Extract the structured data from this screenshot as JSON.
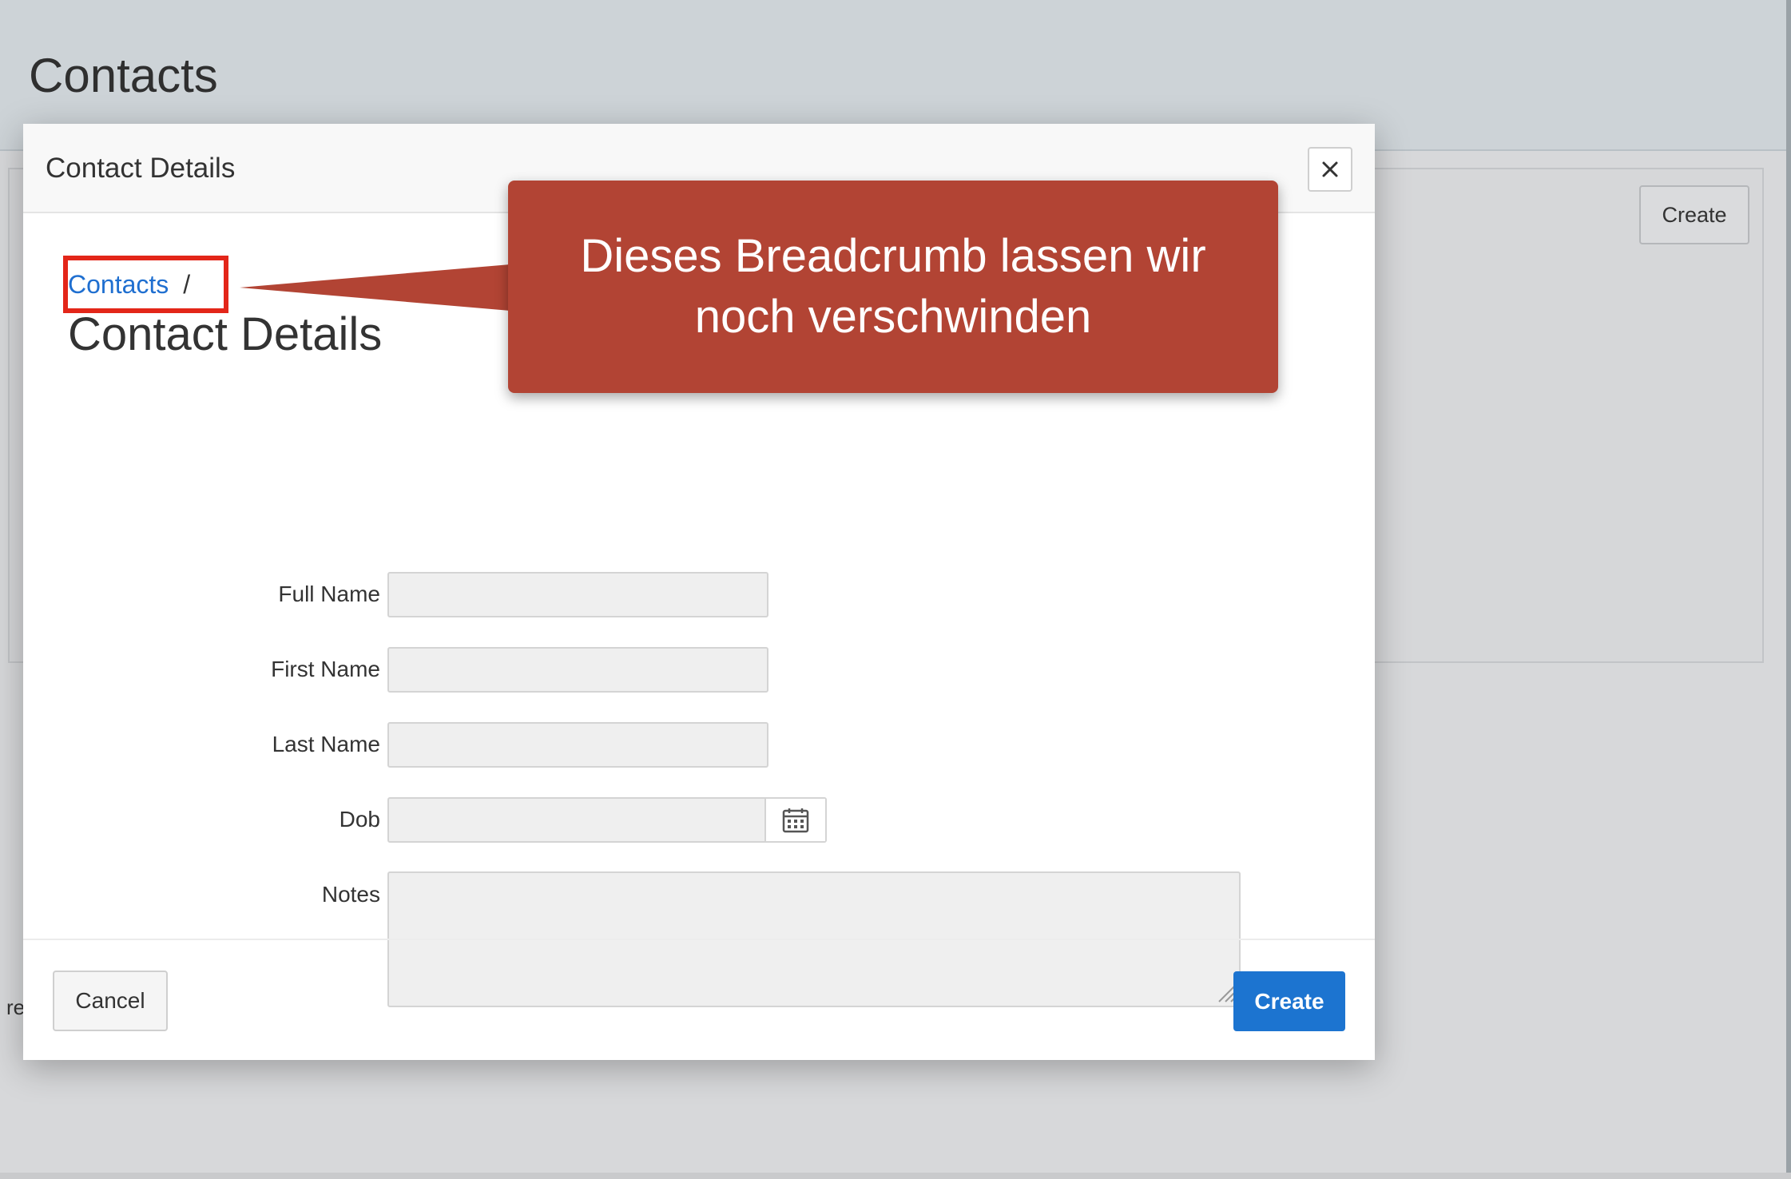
{
  "background": {
    "page_title": "Contacts",
    "create_label": "Create",
    "stray_text": "re"
  },
  "dialog": {
    "title": "Contact Details",
    "close_glyph": "✕",
    "breadcrumb": {
      "link_label": "Contacts",
      "separator": "/"
    },
    "heading": "Contact Details",
    "fields": {
      "full_name": {
        "label": "Full Name",
        "value": ""
      },
      "first_name": {
        "label": "First Name",
        "value": ""
      },
      "last_name": {
        "label": "Last Name",
        "value": ""
      },
      "dob": {
        "label": "Dob",
        "value": "",
        "icon": "calendar-icon"
      },
      "notes": {
        "label": "Notes",
        "value": ""
      }
    },
    "footer": {
      "cancel_label": "Cancel",
      "create_label": "Create"
    }
  },
  "callout": {
    "line1": "Dieses Breadcrumb lassen wir",
    "line2": "noch verschwinden",
    "color": "#b24434",
    "highlight_color": "#e32619"
  },
  "colors": {
    "primary": "#1c74d0",
    "link": "#1f6fd0"
  }
}
